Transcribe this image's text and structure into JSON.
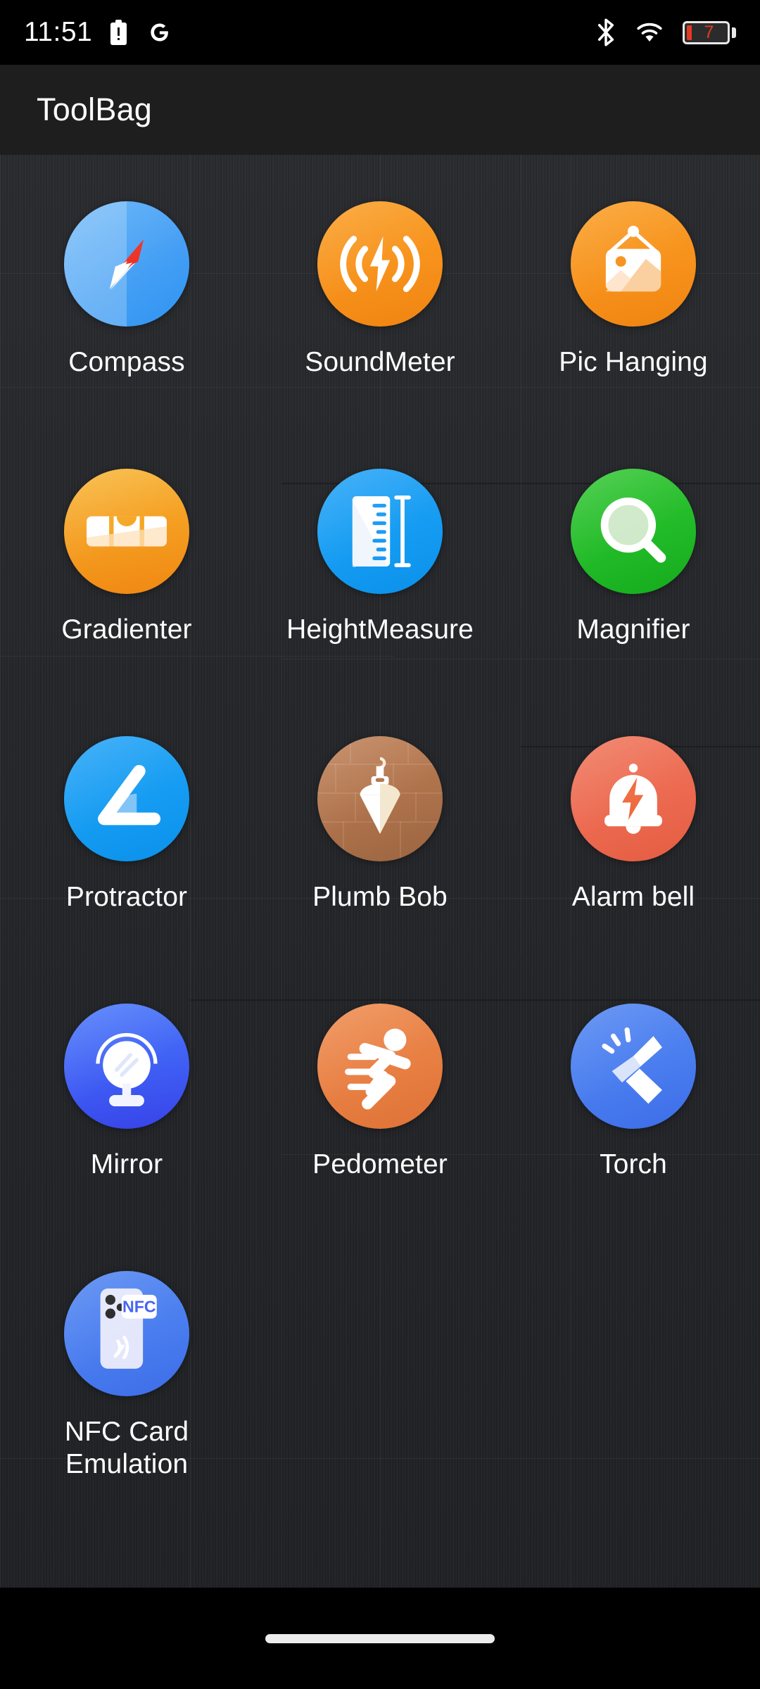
{
  "status_bar": {
    "time": "11:51",
    "battery_percent": "7",
    "icons": [
      {
        "name": "battery-alert-icon",
        "label": "battery alert"
      },
      {
        "name": "google-icon",
        "label": "G"
      },
      {
        "name": "bluetooth-icon",
        "label": "bluetooth"
      },
      {
        "name": "wifi-icon",
        "label": "wifi"
      },
      {
        "name": "battery-level-icon",
        "label": "battery 7%"
      }
    ]
  },
  "app_bar": {
    "title": "ToolBag"
  },
  "apps": [
    {
      "id": "compass",
      "label": "Compass",
      "icon": "compass-icon",
      "color": "#4AA2F5"
    },
    {
      "id": "soundmeter",
      "label": "SoundMeter",
      "icon": "sound-meter-icon",
      "color": "#F7921C"
    },
    {
      "id": "pic-hanging",
      "label": "Pic Hanging",
      "icon": "picture-frame-icon",
      "color": "#F7921C"
    },
    {
      "id": "gradienter",
      "label": "Gradienter",
      "icon": "spirit-level-icon",
      "color": "#F59F22"
    },
    {
      "id": "heightmeasure",
      "label": "HeightMeasure",
      "icon": "ruler-icon",
      "color": "#159CF2"
    },
    {
      "id": "magnifier",
      "label": "Magnifier",
      "icon": "magnifying-glass-icon",
      "color": "#22BB28"
    },
    {
      "id": "protractor",
      "label": "Protractor",
      "icon": "angle-icon",
      "color": "#159CF2"
    },
    {
      "id": "plumb-bob",
      "label": "Plumb Bob",
      "icon": "plumb-bob-icon",
      "color": "#B0744C"
    },
    {
      "id": "alarm-bell",
      "label": "Alarm bell",
      "icon": "bell-icon",
      "color": "#EC6A50"
    },
    {
      "id": "mirror",
      "label": "Mirror",
      "icon": "mirror-icon",
      "color": "#3F5EF4"
    },
    {
      "id": "pedometer",
      "label": "Pedometer",
      "icon": "running-person-icon",
      "color": "#E87F43"
    },
    {
      "id": "torch",
      "label": "Torch",
      "icon": "flashlight-icon",
      "color": "#4A7DEF"
    },
    {
      "id": "nfc-card",
      "label": "NFC Card Emulation",
      "icon": "nfc-phone-icon",
      "color": "#4A7DEF",
      "badge_text": "NFC"
    }
  ],
  "nav_bar": {
    "gesture_pill": "home gesture bar"
  }
}
